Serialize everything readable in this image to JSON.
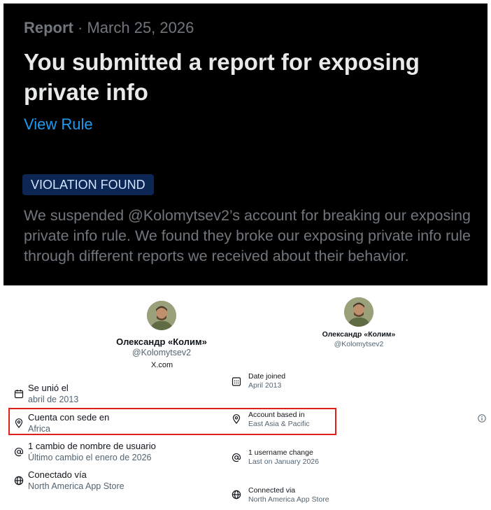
{
  "report": {
    "kind": "Report",
    "separator": "·",
    "date": "March 25, 2026",
    "title": "You submitted a report for exposing private info",
    "view_rule": "View Rule",
    "badge": "VIOLATION FOUND",
    "body": "We suspended @Kolomytsev2’s account for breaking our exposing private info rule. We found they broke our exposing private info rule through different reports we received about their behavior."
  },
  "profile_es": {
    "name": "Олександр «Колим»",
    "handle": "@Kolomytsev2",
    "site": "X.com",
    "rows": [
      {
        "icon": "calendar-icon",
        "label": "Se unió el",
        "value": "abril de 2013"
      },
      {
        "icon": "location-pin-icon",
        "label": "Cuenta con sede en",
        "value": "Africa"
      },
      {
        "icon": "at-sign-icon",
        "label": "1 cambio de nombre de usuario",
        "value": "Último cambio el enero de 2026"
      },
      {
        "icon": "globe-icon",
        "label": "Conectado vía",
        "value": "North America App Store"
      }
    ]
  },
  "profile_en": {
    "name": "Олександр «Колим»",
    "handle": "@Kolomytsev2",
    "rows": [
      {
        "icon": "calendar-icon",
        "label": "Date joined",
        "value": "April 2013"
      },
      {
        "icon": "location-pin-icon",
        "label": "Account based in",
        "value": "East Asia & Pacific"
      },
      {
        "icon": "at-sign-icon",
        "label": "1 username change",
        "value": "Last on January 2026"
      },
      {
        "icon": "globe-icon",
        "label": "Connected via",
        "value": "North America App Store"
      }
    ]
  },
  "colors": {
    "panel_bg": "#000000",
    "accent_blue": "#1d9bf0",
    "badge_bg": "#0c2754",
    "highlight_red": "#e0201a"
  },
  "info_icon": "info-circle-icon"
}
